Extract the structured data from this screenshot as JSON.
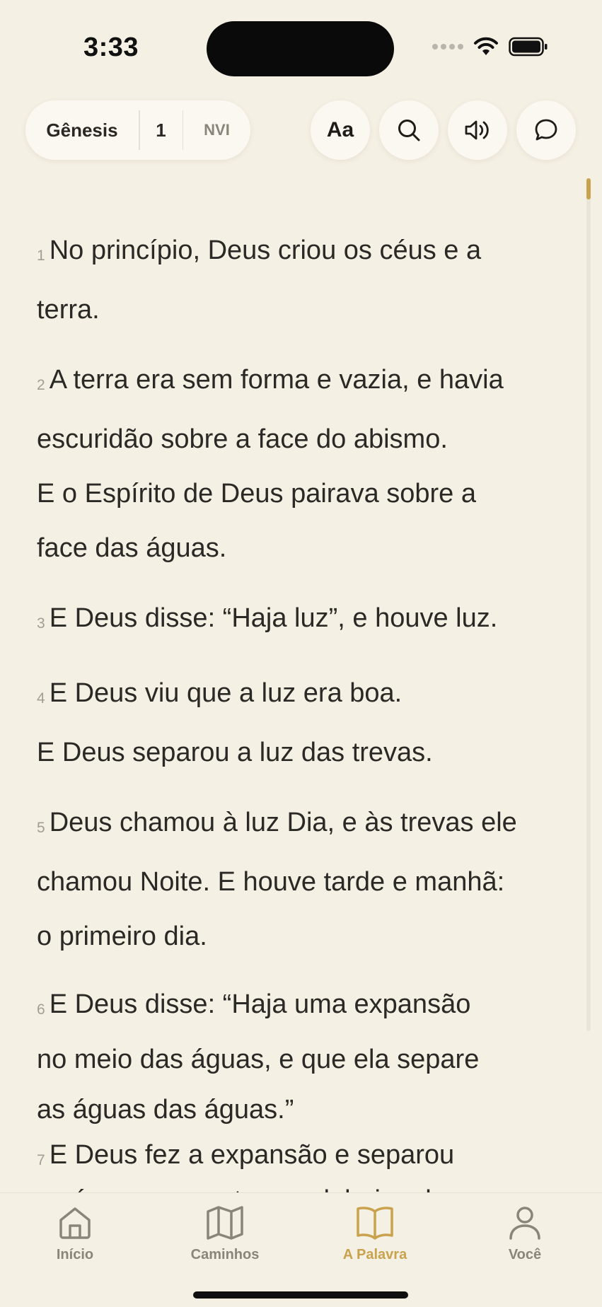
{
  "status_bar": {
    "time": "3:33"
  },
  "header": {
    "book": "Gênesis",
    "chapter": "1",
    "version": "NVI",
    "font_button_label": "Aa"
  },
  "verses": [
    {
      "num": "1",
      "lines": [
        "No princípio, Deus criou os céus e a",
        "terra."
      ]
    },
    {
      "num": "2",
      "lines": [
        "A terra era sem forma e vazia, e havia",
        "escuridão sobre a face do abismo.",
        "E o Espírito de Deus pairava sobre a",
        "face das águas."
      ]
    },
    {
      "num": "3",
      "lines": [
        "E Deus disse: “Haja luz”, e houve luz."
      ]
    },
    {
      "num": "4",
      "lines": [
        "E Deus viu que a luz era boa.",
        "E Deus separou a luz das trevas."
      ]
    },
    {
      "num": "5",
      "lines": [
        "Deus chamou à luz Dia, e às trevas ele",
        "chamou Noite. E houve tarde e manhã:",
        "o primeiro dia."
      ]
    },
    {
      "num": "6",
      "lines": [
        "E Deus disse: “Haja uma expansão",
        "no meio das águas, e que ela separe",
        "as águas das águas.”"
      ]
    },
    {
      "num": "7",
      "lines": [
        "E Deus fez a expansão e separou",
        "as águas que estavam debaixo da"
      ]
    }
  ],
  "nav": [
    {
      "label": "Início",
      "icon": "home-icon"
    },
    {
      "label": "Caminhos",
      "icon": "map-icon"
    },
    {
      "label": "A Palavra",
      "icon": "book-icon",
      "active": true
    },
    {
      "label": "Você",
      "icon": "person-icon"
    }
  ],
  "colors": {
    "background": "#f5f0e4",
    "accent": "#c9a24e",
    "text": "#2b2925",
    "muted": "#8a857b"
  }
}
